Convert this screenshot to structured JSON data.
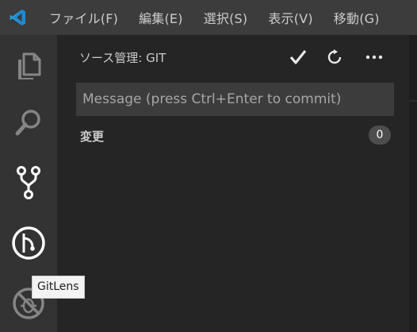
{
  "menu": {
    "items": [
      {
        "label": "ファイル(F)"
      },
      {
        "label": "編集(E)"
      },
      {
        "label": "選択(S)"
      },
      {
        "label": "表示(V)"
      },
      {
        "label": "移動(G)"
      }
    ]
  },
  "activity_bar": {
    "items": [
      {
        "icon": "files-icon"
      },
      {
        "icon": "search-icon"
      },
      {
        "icon": "source-control-icon"
      },
      {
        "icon": "gitlens-icon"
      },
      {
        "icon": "debug-icon"
      }
    ]
  },
  "scm": {
    "title": "ソース管理: GIT",
    "actions": [
      "commit-check-icon",
      "refresh-icon",
      "more-icon"
    ],
    "commit_input": {
      "value": "",
      "placeholder": "Message (press Ctrl+Enter to commit)"
    },
    "changes": {
      "label": "変更",
      "count": "0"
    }
  },
  "tooltip": {
    "text": "GitLens"
  },
  "colors": {
    "titlebar": "#3c3c3c",
    "activitybar": "#333333",
    "sidebar": "#252526",
    "input": "#3c3c3c",
    "vscode_blue": "#23a9f2"
  }
}
